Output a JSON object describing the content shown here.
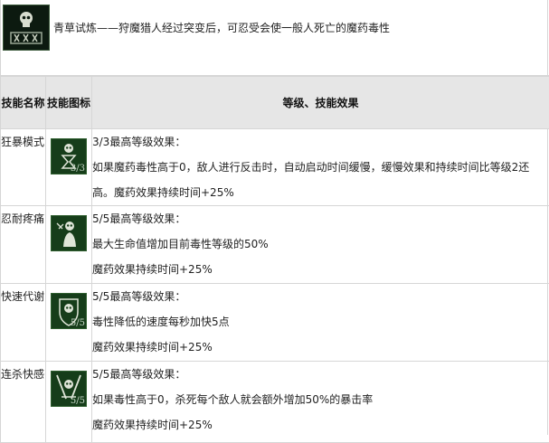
{
  "intro": {
    "icon": "toxic-skull-emblem-icon",
    "text": "青草试炼——狩魔猎人经过突变后，可忍受会使一般人死亡的魔药毒性"
  },
  "table": {
    "headers": {
      "name": "技能名称",
      "icon": "技能图标",
      "effect": "等级、技能效果"
    },
    "rows": [
      {
        "name": "狂暴模式",
        "icon": "skull-hourglass-icon",
        "rank": "3/3",
        "lines": [
          "3/3最高等级效果：",
          "如果魔药毒性高于0，敌人进行反击时，自动启动时间缓慢，缓慢效果和持续时间比等级2还高。魔药效果持续时间+25%"
        ]
      },
      {
        "name": "忍耐疼痛",
        "icon": "skull-figure-icon",
        "rank": "",
        "lines": [
          "5/5最高等级效果：",
          "最大生命值增加目前毒性等级的50%",
          "魔药效果持续时间+25%"
        ]
      },
      {
        "name": "快速代谢",
        "icon": "skull-shield-icon",
        "rank": "5/5",
        "lines": [
          "5/5最高等级效果：",
          "毒性降低的速度每秒加快5点",
          "魔药效果持续时间+25%"
        ]
      },
      {
        "name": "连杀快感",
        "icon": "skull-swords-icon",
        "rank": "5/5",
        "lines": [
          "5/5最高等级效果：",
          "如果毒性高于0，杀死每个敌人就会额外增加50%的暴击率",
          "魔药效果持续时间+25%"
        ]
      }
    ]
  },
  "colors": {
    "header_bg": "#e6e6e6",
    "border": "#d6d6d6",
    "icon_bg": "#163d1a"
  }
}
